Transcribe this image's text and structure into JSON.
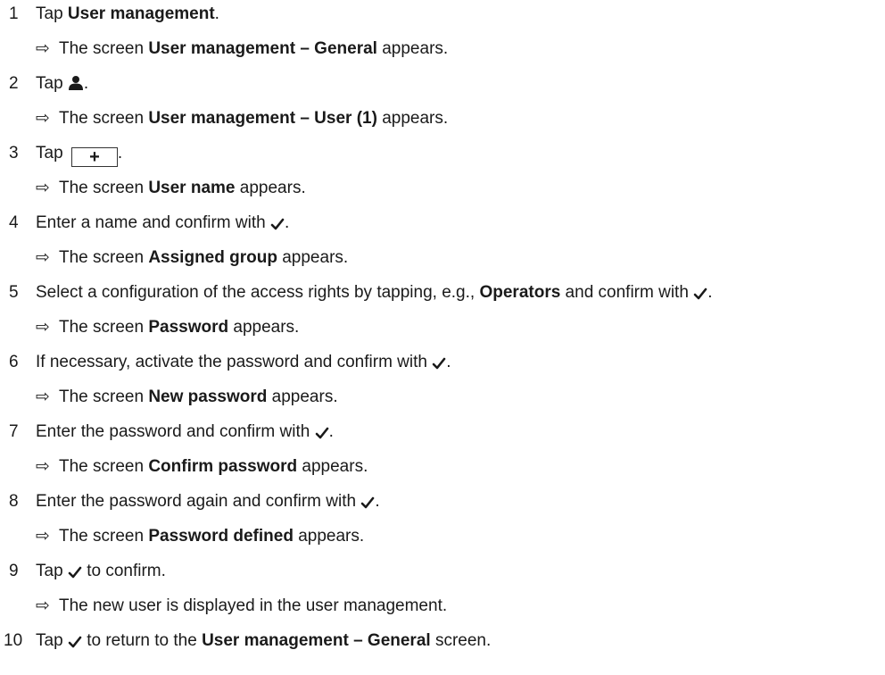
{
  "steps": [
    {
      "num": "1",
      "text": {
        "pre": "Tap ",
        "bold": "User management",
        "post": "."
      },
      "result": {
        "pre": "The screen ",
        "bold": "User management – General",
        "post": " appears."
      }
    },
    {
      "num": "2",
      "text": {
        "pre": "Tap ",
        "icon": "user-icon",
        "post": "."
      },
      "result": {
        "pre": "The screen ",
        "bold": "User management – User (1)",
        "post": " appears."
      }
    },
    {
      "num": "3",
      "text": {
        "pre": "Tap ",
        "button": "+",
        "post": "."
      },
      "result": {
        "pre": "The screen ",
        "bold": "User name",
        "post": " appears."
      }
    },
    {
      "num": "4",
      "text": {
        "pre": "Enter a name and confirm with ",
        "icon": "check-icon",
        "post": "."
      },
      "result": {
        "pre": "The screen ",
        "bold": "Assigned group",
        "post": " appears."
      }
    },
    {
      "num": "5",
      "text": {
        "pre": "Select a configuration of the access rights by tapping, e.g., ",
        "bold": "Operators",
        "mid": " and confirm with ",
        "icon": "check-icon",
        "post": "."
      },
      "result": {
        "pre": "The screen ",
        "bold": "Password",
        "post": " appears."
      }
    },
    {
      "num": "6",
      "text": {
        "pre": "If necessary, activate the password and confirm with ",
        "icon": "check-icon",
        "post": "."
      },
      "result": {
        "pre": "The screen ",
        "bold": "New password",
        "post": " appears."
      }
    },
    {
      "num": "7",
      "text": {
        "pre": "Enter the password and confirm with ",
        "icon": "check-icon",
        "post": "."
      },
      "result": {
        "pre": "The screen ",
        "bold": "Confirm password",
        "post": " appears."
      }
    },
    {
      "num": "8",
      "text": {
        "pre": "Enter the password again and confirm with ",
        "icon": "check-icon",
        "post": "."
      },
      "result": {
        "pre": "The screen ",
        "bold": "Password defined",
        "post": " appears."
      }
    },
    {
      "num": "9",
      "text": {
        "pre": "Tap ",
        "icon": "check-icon",
        "post": " to confirm."
      },
      "result": {
        "pre": "The new user is displayed in the user management."
      }
    },
    {
      "num": "10",
      "text": {
        "pre": "Tap ",
        "icon": "check-icon",
        "mid": " to return to the ",
        "bold": "User management – General",
        "post": " screen."
      }
    }
  ],
  "result_arrow": "⇨"
}
